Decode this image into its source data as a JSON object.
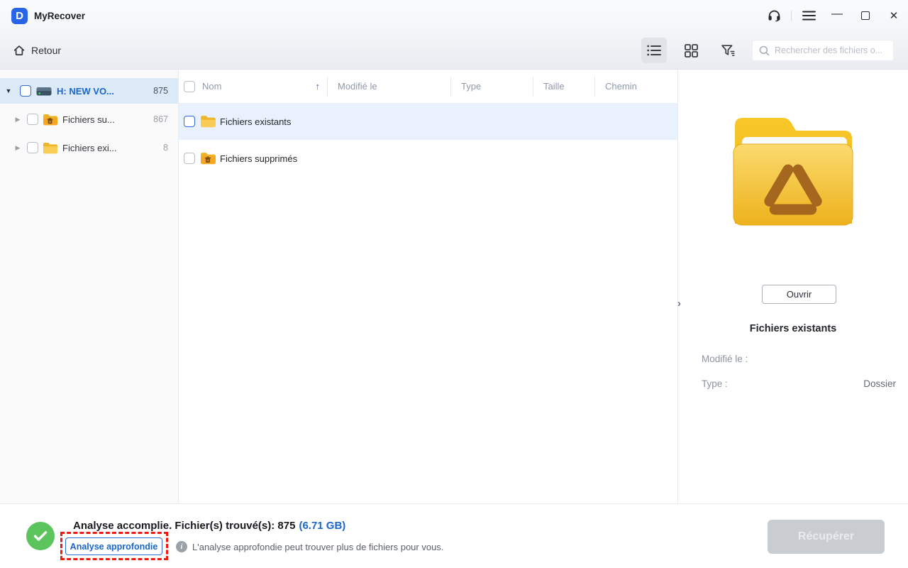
{
  "app": {
    "name": "MyRecover",
    "logo_letter": "D"
  },
  "titlebar": {
    "icons": {
      "support": "headset",
      "menu": "hamburger",
      "minimize": "–",
      "maximize": "square",
      "close": "✕"
    }
  },
  "toolbar": {
    "back_label": "Retour",
    "search_placeholder": "Rechercher des fichiers o...",
    "view_modes": [
      "list",
      "grid"
    ],
    "filter_icon": "funnel"
  },
  "sidebar": {
    "items": [
      {
        "caret": "▼",
        "icon": "drive",
        "label": "H: NEW VO...",
        "count": "875",
        "selected": true
      },
      {
        "caret": "▶",
        "icon": "folder-deleted",
        "label": "Fichiers su...",
        "count": "867",
        "selected": false
      },
      {
        "caret": "▶",
        "icon": "folder",
        "label": "Fichiers exi...",
        "count": "8",
        "selected": false
      }
    ]
  },
  "table": {
    "headers": [
      "Nom",
      "Modifié le",
      "Type",
      "Taille",
      "Chemin"
    ],
    "sort_icon": "↑",
    "rows": [
      {
        "icon": "folder",
        "name": "Fichiers existants",
        "selected": true
      },
      {
        "icon": "folder-deleted",
        "name": "Fichiers supprimés",
        "selected": false
      }
    ]
  },
  "details": {
    "collapse_icon": "›",
    "preview_icon": "recycle-folder",
    "open_button": "Ouvrir",
    "title": "Fichiers existants",
    "fields": [
      {
        "label": "Modifié le :",
        "value": ""
      },
      {
        "label": "Type :",
        "value": "Dossier"
      }
    ]
  },
  "statusbar": {
    "status_icon": "check-circle",
    "message": "Analyse accomplie. Fichier(s) trouvé(s): 875",
    "size": "(6.71 GB)",
    "deep_scan_button": "Analyse approfondie",
    "info_hint": "L'analyse approfondie peut trouver plus de fichiers pour vous.",
    "recover_button": "Récupérer"
  },
  "colors": {
    "accent_blue": "#1a66c9",
    "selected_row_blue": "#dce9f7",
    "table_selected_blue": "#e9f2fc",
    "success_green": "#5bc45c",
    "annotation_red": "#ee1b11",
    "folder_yellow": "#f7c948",
    "disabled_gray": "#c9cdd2"
  }
}
